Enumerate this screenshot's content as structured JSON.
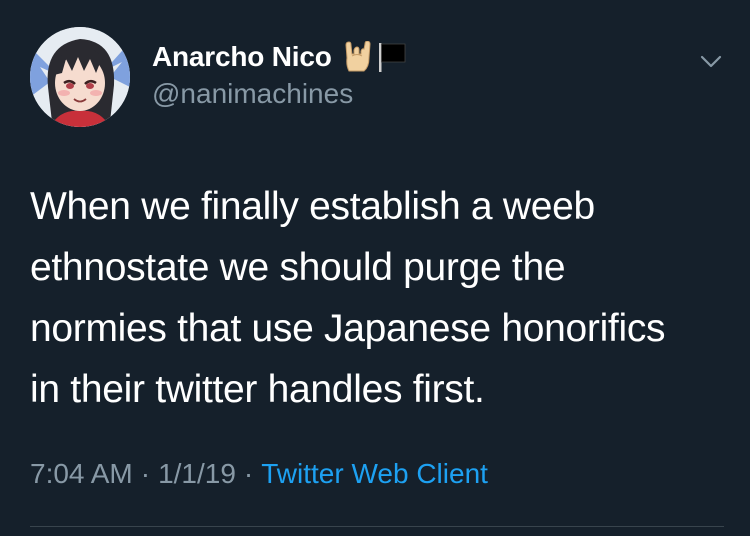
{
  "author": {
    "display_name": "Anarcho Nico",
    "handle": "@nanimachines",
    "name_emojis": [
      "sign-of-the-horns-icon",
      "black-flag-icon"
    ]
  },
  "tweet": {
    "lines": [
      "When we finally establish a weeb",
      "ethnostate we should purge the",
      "normies that use Japanese honorifics",
      "in their twitter handles first."
    ],
    "time": "7:04 AM",
    "date": "1/1/19",
    "separator": "·",
    "client": "Twitter Web Client"
  },
  "theme": {
    "background": "#15202b",
    "text": "#ffffff",
    "muted": "#8899a6",
    "link": "#1da1f2",
    "divider": "#38444d"
  }
}
